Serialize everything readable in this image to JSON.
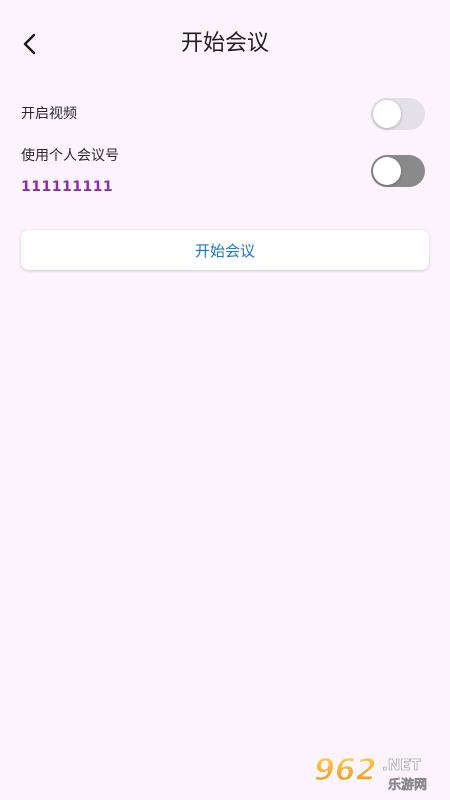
{
  "header": {
    "title": "开始会议"
  },
  "settings": {
    "video": {
      "label": "开启视频",
      "enabled": false,
      "track_color": "#e4e0e8"
    },
    "personal_id": {
      "label": "使用个人会议号",
      "id_value": "111111111",
      "enabled": false,
      "track_color": "#8a8a8a"
    }
  },
  "start_button": {
    "label": "开始会议"
  },
  "watermark": {
    "number": "962",
    "suffix": ".NET",
    "subtitle": "乐游网"
  },
  "colors": {
    "background": "#fcf3fd",
    "accent_purple": "#8c2fa6",
    "button_text": "#1b77c7"
  }
}
